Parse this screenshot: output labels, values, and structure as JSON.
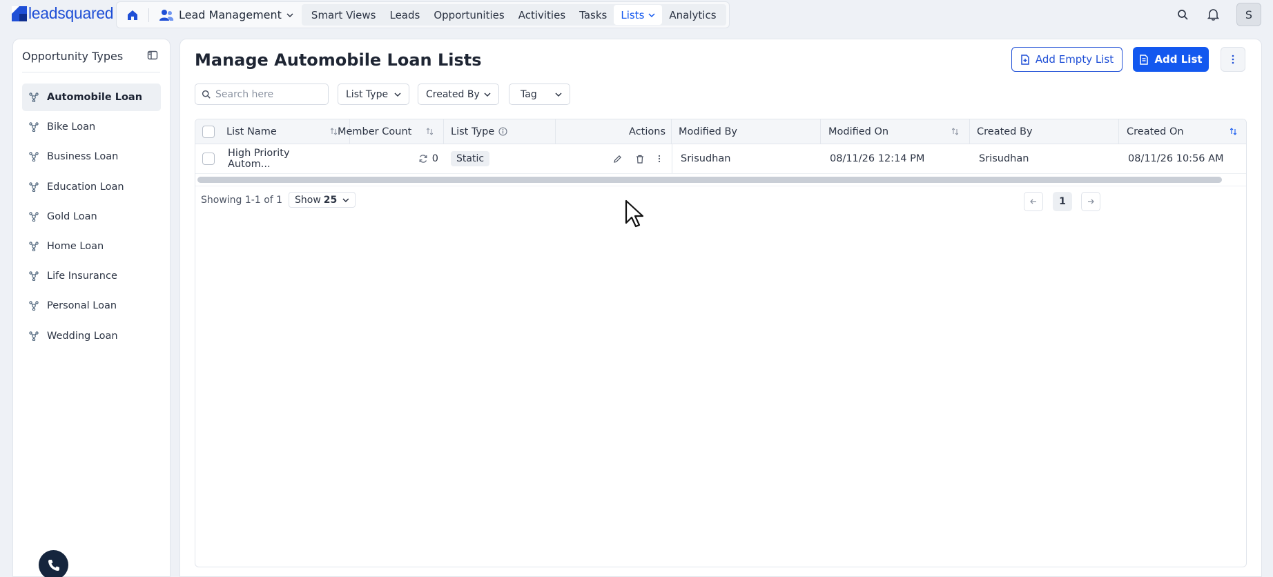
{
  "brand": {
    "name": "leadsquared",
    "color": "#1f4fd6"
  },
  "nav": {
    "module": "Lead Management",
    "items": [
      {
        "label": "Smart Views"
      },
      {
        "label": "Leads"
      },
      {
        "label": "Opportunities"
      },
      {
        "label": "Activities"
      },
      {
        "label": "Tasks"
      },
      {
        "label": "Lists",
        "active": true,
        "has_dropdown": true
      },
      {
        "label": "Analytics"
      }
    ],
    "avatar": "S"
  },
  "sidebar": {
    "title": "Opportunity Types",
    "items": [
      {
        "label": "Automobile Loan",
        "active": true
      },
      {
        "label": "Bike Loan"
      },
      {
        "label": "Business Loan"
      },
      {
        "label": "Education Loan"
      },
      {
        "label": "Gold Loan"
      },
      {
        "label": "Home Loan"
      },
      {
        "label": "Life Insurance"
      },
      {
        "label": "Personal Loan"
      },
      {
        "label": "Wedding Loan"
      }
    ]
  },
  "main": {
    "title": "Manage Automobile Loan Lists",
    "add_empty_list": "Add Empty List",
    "add_list": "Add List",
    "search_placeholder": "Search here",
    "filters": [
      {
        "label": "List Type"
      },
      {
        "label": "Created By"
      },
      {
        "label": "Tag"
      }
    ]
  },
  "table": {
    "columns": {
      "list_name": "List Name",
      "member_count": "Member Count",
      "list_type": "List Type",
      "actions": "Actions",
      "modified_by": "Modified By",
      "modified_on": "Modified On",
      "created_by": "Created By",
      "created_on": "Created On"
    },
    "rows": [
      {
        "list_name": "High Priority Autom...",
        "member_count": "0",
        "list_type": "Static",
        "modified_by": "Srisudhan",
        "modified_on": "08/11/26 12:14 PM",
        "created_by": "Srisudhan",
        "created_on": "08/11/26 10:56 AM"
      }
    ],
    "footer": {
      "showing": "Showing 1-1 of 1",
      "show_label": "Show",
      "page_size": "25",
      "current_page": "1"
    }
  },
  "colors": {
    "primary": "#1358ef",
    "background": "#eef1f6",
    "phone_button": "#15253d"
  }
}
